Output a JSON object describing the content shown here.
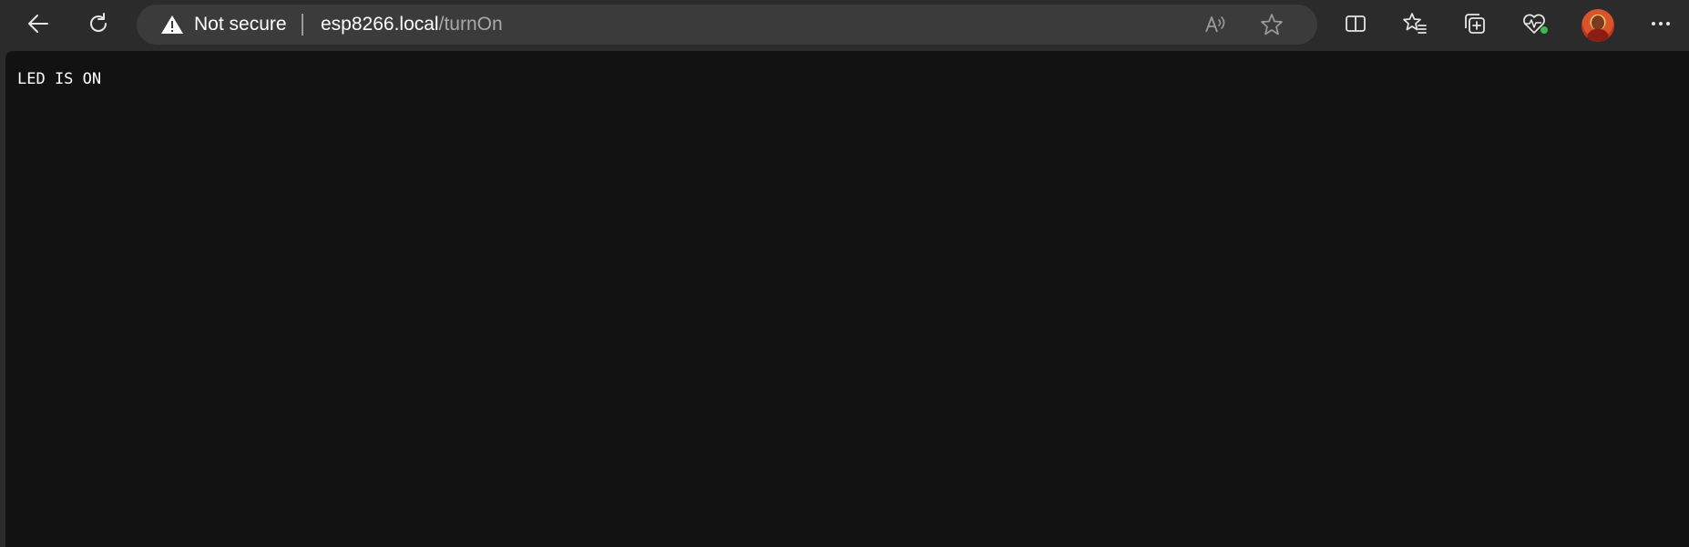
{
  "browser": {
    "nav": {
      "back_icon": "arrow-left-icon",
      "refresh_icon": "refresh-icon"
    },
    "address_bar": {
      "security_icon": "warning-icon",
      "security_text": "Not secure",
      "url_host": "esp8266.local",
      "url_path": "/turnOn",
      "read_aloud_icon": "read-aloud-icon",
      "favorite_icon": "star-outline-icon"
    },
    "toolbar_icons": [
      "split-screen-icon",
      "favorites-icon",
      "collections-icon",
      "browser-essentials-icon",
      "profile-avatar",
      "more-icon"
    ],
    "status_dot_color": "#3fb950"
  },
  "page": {
    "body_text": "LED IS ON"
  },
  "colors": {
    "toolbar_bg": "#2b2b2b",
    "address_bg": "#3b3b3b",
    "page_bg": "#121212",
    "text": "#ffffff",
    "url_path": "#a8a8a8"
  }
}
